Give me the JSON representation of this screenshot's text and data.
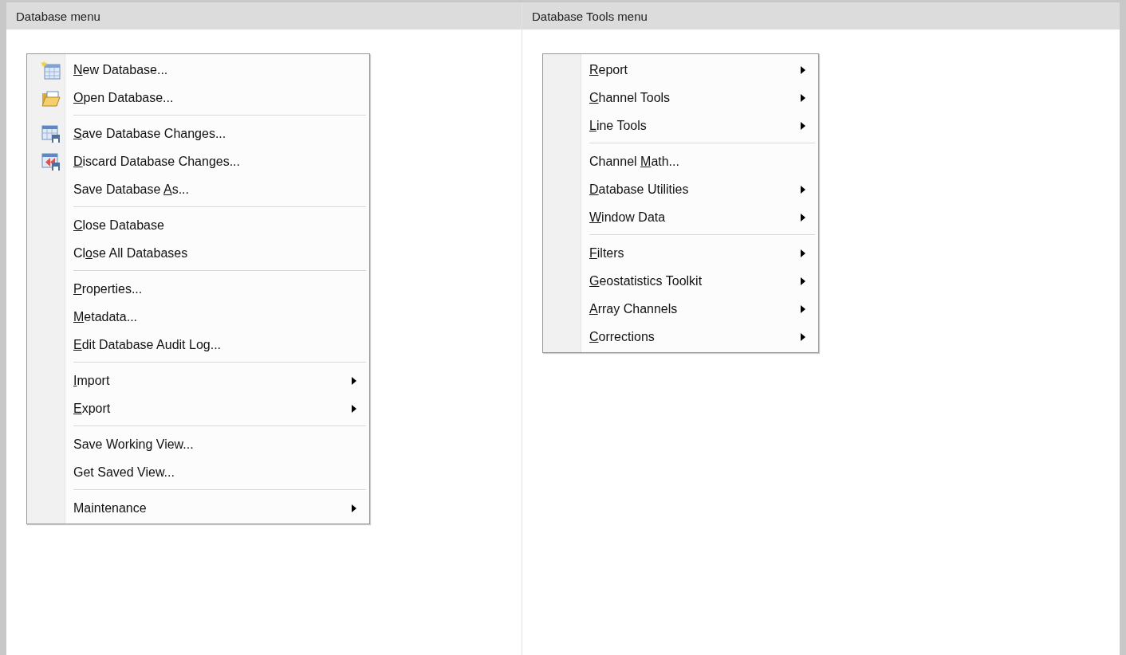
{
  "columns": [
    {
      "heading": "Database menu",
      "menu": [
        {
          "kind": "command",
          "key": "N",
          "post": "ew Database...",
          "icon": true,
          "submenu": false
        },
        {
          "kind": "command",
          "key": "O",
          "post": "pen Database...",
          "icon": true,
          "submenu": false
        },
        {
          "kind": "separator"
        },
        {
          "kind": "command",
          "key": "S",
          "post": "ave Database Changes...",
          "icon": true,
          "submenu": false
        },
        {
          "kind": "command",
          "key": "D",
          "post": "iscard Database Changes...",
          "icon": true,
          "submenu": false
        },
        {
          "kind": "command",
          "pre": "Save Database ",
          "key": "A",
          "post": "s...",
          "icon": false,
          "submenu": false
        },
        {
          "kind": "separator"
        },
        {
          "kind": "command",
          "key": "C",
          "post": "lose Database",
          "icon": false,
          "submenu": false
        },
        {
          "kind": "command",
          "pre": "Cl",
          "key": "o",
          "post": "se All Databases",
          "icon": false,
          "submenu": false
        },
        {
          "kind": "separator"
        },
        {
          "kind": "command",
          "key": "P",
          "post": "roperties...",
          "icon": false,
          "submenu": false
        },
        {
          "kind": "command",
          "key": "M",
          "post": "etadata...",
          "icon": false,
          "submenu": false
        },
        {
          "kind": "command",
          "key": "E",
          "post": "dit Database Audit Log...",
          "icon": false,
          "submenu": false
        },
        {
          "kind": "separator"
        },
        {
          "kind": "command",
          "key": "I",
          "post": "mport",
          "icon": false,
          "submenu": true
        },
        {
          "kind": "command",
          "key": "E",
          "post": "xport",
          "icon": false,
          "submenu": true
        },
        {
          "kind": "separator"
        },
        {
          "kind": "command",
          "pre": "Save Working View...",
          "icon": false,
          "submenu": false
        },
        {
          "kind": "command",
          "pre": "Get Saved View...",
          "icon": false,
          "submenu": false
        },
        {
          "kind": "separator"
        },
        {
          "kind": "command",
          "pre": "Maintenance",
          "icon": false,
          "submenu": true
        }
      ]
    },
    {
      "heading": "Database Tools menu",
      "menu": [
        {
          "kind": "command",
          "key": "R",
          "post": "eport",
          "icon": false,
          "submenu": true
        },
        {
          "kind": "command",
          "key": "C",
          "post": "hannel Tools",
          "icon": false,
          "submenu": true
        },
        {
          "kind": "command",
          "key": "L",
          "post": "ine Tools",
          "icon": false,
          "submenu": true
        },
        {
          "kind": "separator"
        },
        {
          "kind": "command",
          "pre": "Channel ",
          "key": "M",
          "post": "ath...",
          "icon": false,
          "submenu": false
        },
        {
          "kind": "command",
          "key": "D",
          "post": "atabase Utilities",
          "icon": false,
          "submenu": true
        },
        {
          "kind": "command",
          "key": "W",
          "post": "indow Data",
          "icon": false,
          "submenu": true
        },
        {
          "kind": "separator"
        },
        {
          "kind": "command",
          "key": "F",
          "post": "ilters",
          "icon": false,
          "submenu": true
        },
        {
          "kind": "command",
          "key": "G",
          "post": "eostatistics Toolkit",
          "icon": false,
          "submenu": true
        },
        {
          "kind": "command",
          "key": "A",
          "post": "rray Channels",
          "icon": false,
          "submenu": true
        },
        {
          "kind": "command",
          "key": "C",
          "post": "orrections",
          "icon": false,
          "submenu": true
        }
      ]
    }
  ]
}
